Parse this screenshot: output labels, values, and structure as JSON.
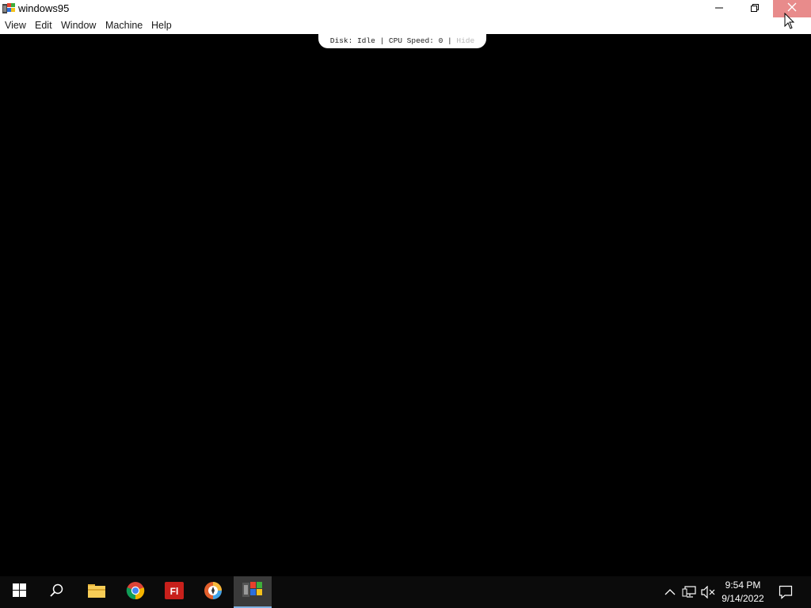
{
  "window": {
    "title": "windows95",
    "controls": {
      "minimize": "minimize-icon",
      "maximize": "restore-icon",
      "close": "close-icon",
      "close_hover_color": "#e88b8b"
    }
  },
  "menu": {
    "items": [
      {
        "label": "View"
      },
      {
        "label": "Edit"
      },
      {
        "label": "Window"
      },
      {
        "label": "Machine"
      },
      {
        "label": "Help"
      }
    ]
  },
  "status": {
    "text": "Disk: Idle | CPU Speed: 0 | ",
    "hide_label": "Hide"
  },
  "taskbar": {
    "background": "#0b0b0b",
    "apps": [
      {
        "name": "start-icon"
      },
      {
        "name": "search-icon"
      },
      {
        "name": "file-explorer-icon"
      },
      {
        "name": "chrome-icon"
      },
      {
        "name": "fl-app-icon",
        "label": "Fl"
      },
      {
        "name": "browser-app-icon"
      },
      {
        "name": "windows95-app-icon",
        "active": true
      }
    ],
    "tray": {
      "icons": [
        "show-hidden-icons-icon",
        "network-icon",
        "volume-muted-icon",
        "notification-icon"
      ]
    },
    "clock": {
      "time": "9:54 PM",
      "date": "9/14/2022"
    }
  }
}
